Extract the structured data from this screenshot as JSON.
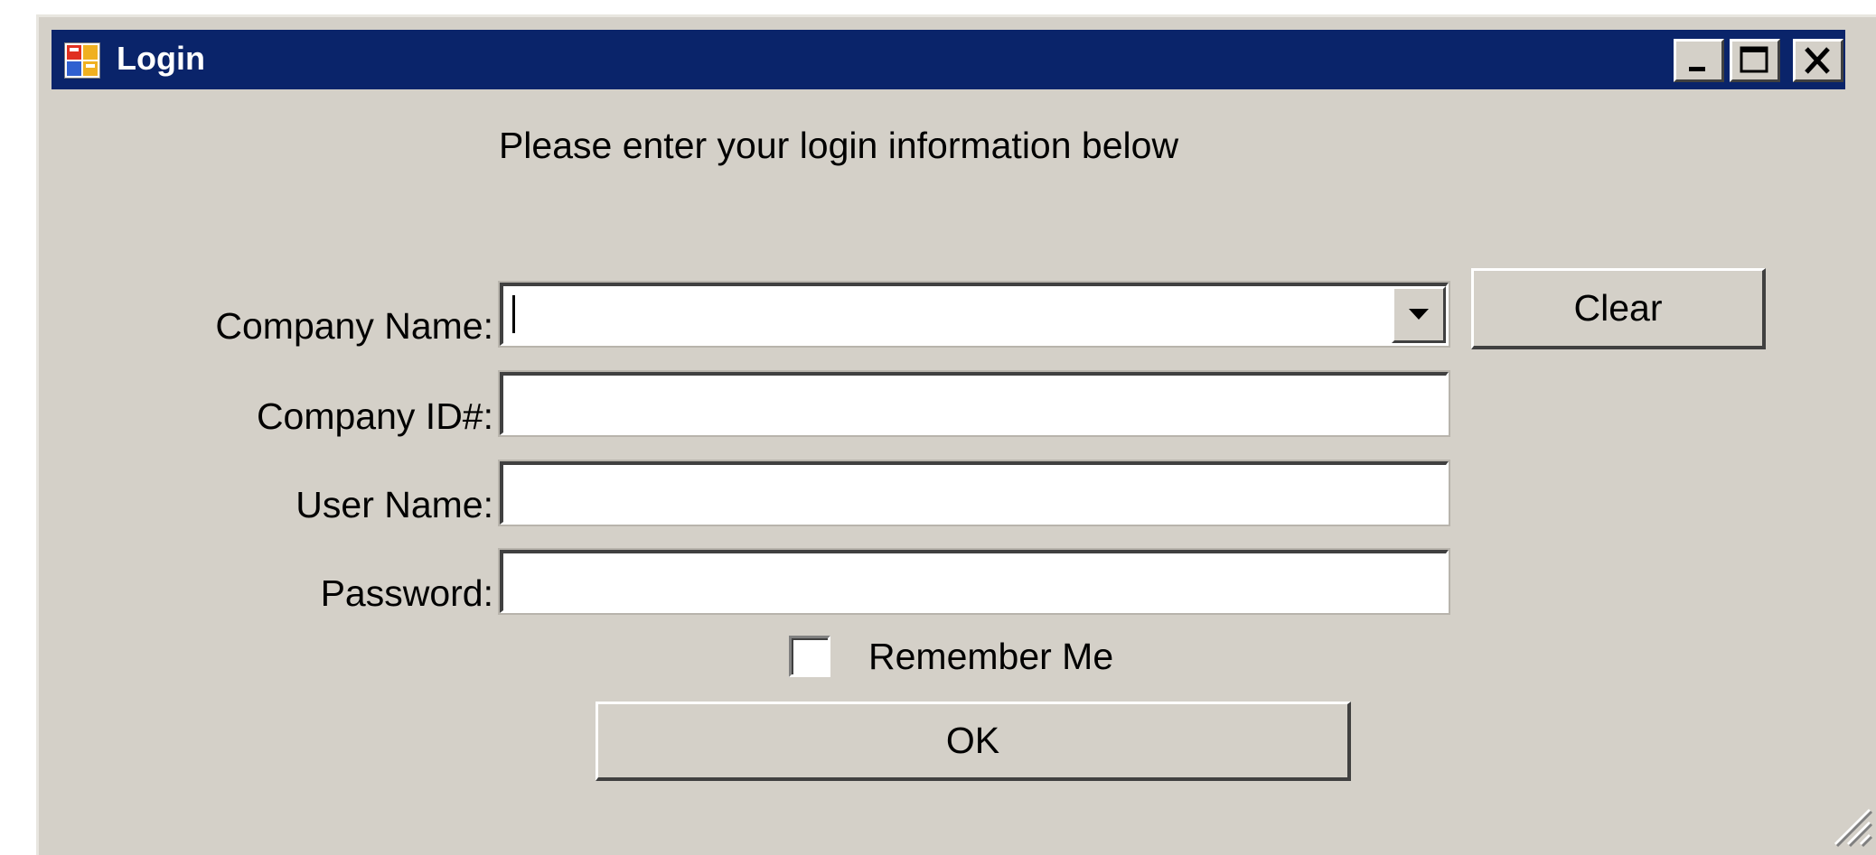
{
  "window": {
    "title": "Login",
    "controls": {
      "minimize": "minimize",
      "maximize": "maximize",
      "close": "close"
    },
    "colors": {
      "titlebar": "#0a246a",
      "background": "#d4d0c8"
    }
  },
  "form": {
    "instruction": "Please enter your login information below",
    "company_name": {
      "label": "Company Name:",
      "value": ""
    },
    "company_id": {
      "label": "Company ID#:",
      "value": ""
    },
    "user_name": {
      "label": "User Name:",
      "value": ""
    },
    "password": {
      "label": "Password:",
      "value": ""
    },
    "remember_me": {
      "label": "Remember Me",
      "checked": false
    },
    "clear_label": "Clear",
    "ok_label": "OK"
  },
  "icons": {
    "app": "app-window-icon",
    "dropdown": "chevron-down-icon",
    "resize": "resize-grip-icon"
  }
}
